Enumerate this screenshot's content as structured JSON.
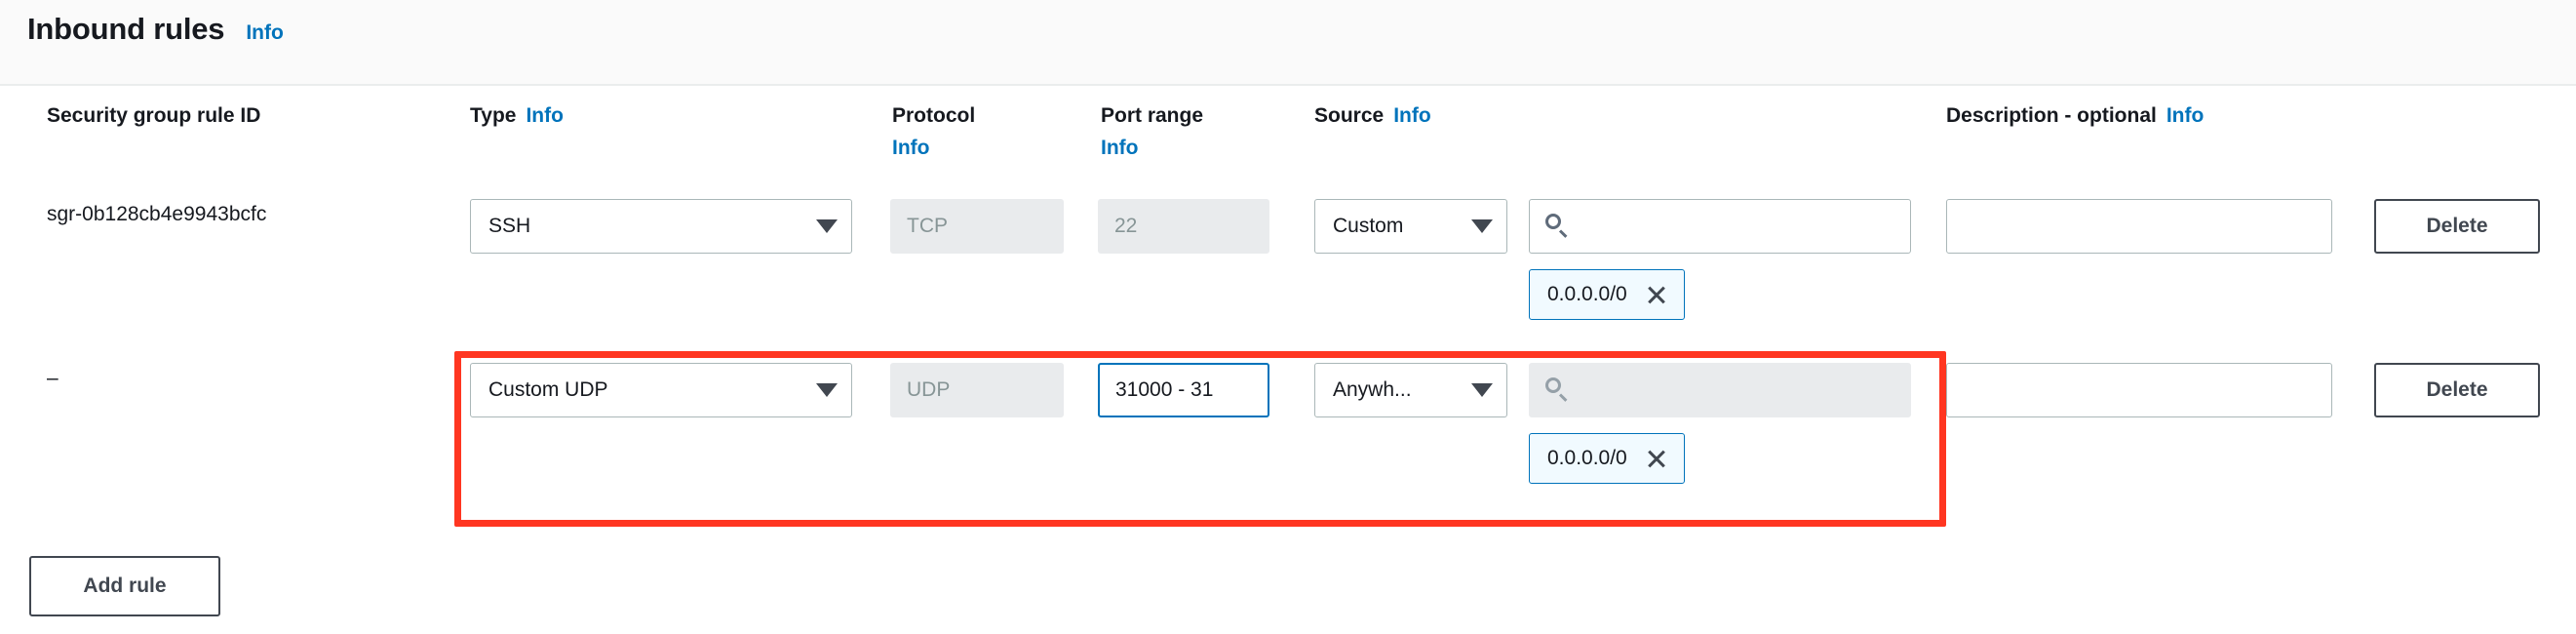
{
  "panel": {
    "title": "Inbound rules",
    "info_label": "Info"
  },
  "columns": {
    "rule_id": "Security group rule ID",
    "type": "Type",
    "type_info": "Info",
    "protocol": "Protocol",
    "protocol_info": "Info",
    "port_range": "Port range",
    "port_range_info": "Info",
    "source": "Source",
    "source_info": "Info",
    "description": "Description - optional",
    "description_info": "Info"
  },
  "rows": [
    {
      "rule_id": "sgr-0b128cb4e9943bcfc",
      "type": "SSH",
      "protocol": "TCP",
      "port_range": "22",
      "source_type": "Custom",
      "source_search_value": "",
      "cidr_token": "0.0.0.0/0",
      "description": "",
      "delete_label": "Delete"
    },
    {
      "rule_id": "–",
      "type": "Custom UDP",
      "protocol": "UDP",
      "port_range": "31000 - 31",
      "source_type": "Anywh...",
      "source_search_value": "",
      "cidr_token": "0.0.0.0/0",
      "description": "",
      "delete_label": "Delete"
    }
  ],
  "add_rule_label": "Add rule",
  "colors": {
    "accent_link": "#0073bb",
    "highlight_box": "#ff3621",
    "token_border": "#0073bb",
    "token_bg": "#f1faff",
    "disabled_bg": "#e9ebed",
    "header_bg": "#fafafa"
  }
}
